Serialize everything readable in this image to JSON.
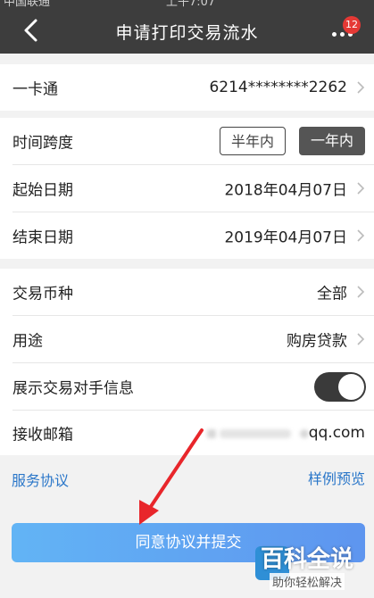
{
  "status_bar": {
    "carrier": "中国联通",
    "time": "上午7:07"
  },
  "header": {
    "title": "申请打印交易流水",
    "badge_count": "12"
  },
  "account": {
    "label": "一卡通",
    "value": "6214********2262"
  },
  "time_range": {
    "label": "时间跨度",
    "options": [
      "半年内",
      "一年内"
    ],
    "selected": "一年内"
  },
  "start_date": {
    "label": "起始日期",
    "value": "2018年04月07日"
  },
  "end_date": {
    "label": "结束日期",
    "value": "2019年04月07日"
  },
  "currency": {
    "label": "交易币种",
    "value": "全部"
  },
  "purpose": {
    "label": "用途",
    "value": "购房贷款"
  },
  "counterparty": {
    "label": "展示交易对手信息",
    "enabled": true
  },
  "email": {
    "label": "接收邮箱",
    "value_visible": "qq.com"
  },
  "links": {
    "service_agreement": "服务协议",
    "sample_preview": "样例预览"
  },
  "submit_label": "同意协议并提交",
  "watermark": {
    "title": "百科全说",
    "subtitle": "助你轻松解决"
  },
  "colors": {
    "header_bg": "#3d3d3d",
    "link": "#2b77c9",
    "button_start": "#62b4f5",
    "button_end": "#5e95ef",
    "arrow": "#e8262b"
  }
}
